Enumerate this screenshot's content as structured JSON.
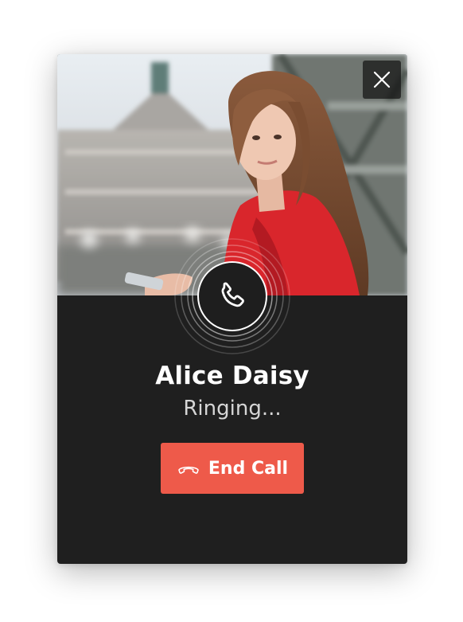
{
  "caller": {
    "name": "Alice Daisy",
    "status": "Ringing..."
  },
  "actions": {
    "end_call_label": "End Call",
    "end_call_icon": "hangup-icon",
    "answer_icon": "phone-icon",
    "close_icon": "close-icon"
  },
  "colors": {
    "panel_bg": "#1f1f1f",
    "end_call_bg": "#ee5a4a",
    "text_primary": "#ffffff",
    "text_secondary": "#d6d6d6"
  }
}
